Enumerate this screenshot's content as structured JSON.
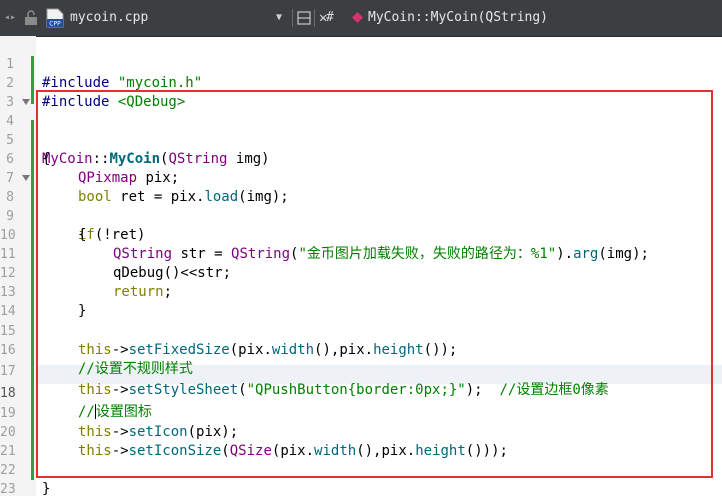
{
  "toolbar": {
    "file_name": "mycoin.cpp",
    "hash": "#",
    "symbol": "MyCoin::MyCoin(QString)",
    "file_icon_text": "CPP"
  },
  "code": {
    "lines": [
      {
        "n": "1"
      },
      {
        "n": "2"
      },
      {
        "n": "3"
      },
      {
        "n": "4"
      },
      {
        "n": "5"
      },
      {
        "n": "6"
      },
      {
        "n": "7"
      },
      {
        "n": "8"
      },
      {
        "n": "9"
      },
      {
        "n": "10"
      },
      {
        "n": "11"
      },
      {
        "n": "12"
      },
      {
        "n": "13"
      },
      {
        "n": "14"
      },
      {
        "n": "15"
      },
      {
        "n": "16"
      },
      {
        "n": "17"
      },
      {
        "n": "18"
      },
      {
        "n": "19"
      },
      {
        "n": "20"
      },
      {
        "n": "21"
      },
      {
        "n": "22"
      },
      {
        "n": "23"
      }
    ],
    "t": {
      "inc": "#include ",
      "h1": "\"mycoin.h\"",
      "h2": "<QDebug>",
      "cls": "MyCoin",
      "sep": "::",
      "ctor": "MyCoin",
      "p_open": "(",
      "qstring": "QString",
      "img_arg": " img)",
      "brace_open": "{",
      "brace_close": "}",
      "qpixmap": "QPixmap",
      "pix_decl": " pix;",
      "bool": "bool",
      "ret_assign": " ret = pix.",
      "load": "load",
      "load_args": "(img);",
      "if": "if",
      "if_cond": "(!ret)",
      "str_assign": " str = ",
      "qstring_ctor": "QString",
      "paren": "(",
      "msg": "\"金币图片加载失败，失败的路径为：%1\"",
      "close_dot": ").",
      "arg": "arg",
      "arg_args": "(img);",
      "qdebug": "qDebug",
      "qdebug_rest": "()<<str;",
      "return": "return",
      "semi": ";",
      "this": "this",
      "arrow": "->",
      "setfixed": "setFixedSize",
      "pix_dot": "(pix.",
      "width": "width",
      "comma_pix": "(),pix.",
      "height": "height",
      "end_call": "());",
      "c_irregular": "//设置不规则样式",
      "setstyle": "setStyleSheet",
      "style_str": "\"QPushButton{border:0px;}\"",
      "style_end": ");  ",
      "c_border": "//设置边框0像素",
      "c_icon_a": "//",
      "c_icon_b": "设置图标",
      "seticon": "setIcon",
      "seticon_args": "(pix);",
      "seticonsize": "setIconSize",
      "qsize": "QSize",
      "end_call2": "()));"
    }
  },
  "colors": {
    "accent_box": "#e03030",
    "change_bar": "#2ea043",
    "toolbar_bg": "#3c3f41"
  }
}
